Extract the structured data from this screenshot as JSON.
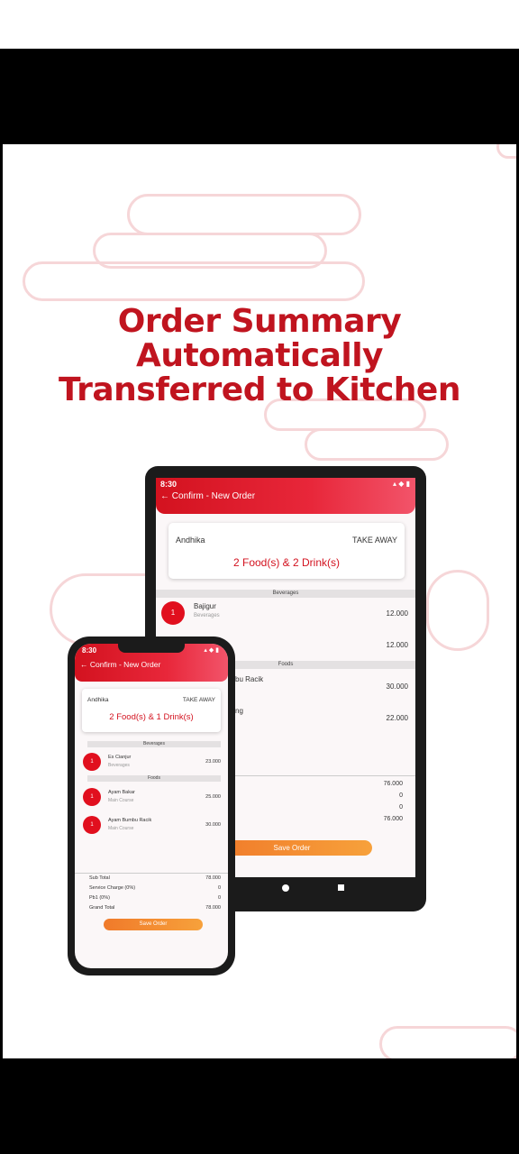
{
  "headline": {
    "line1": "Order Summary",
    "line2": "Automatically",
    "line3": "Transferred to Kitchen"
  },
  "tablet": {
    "time": "8:30",
    "status_icons": "▴ ◆ ▮",
    "back_icon": "←",
    "title": "Confirm - New Order",
    "customer": "Andhika",
    "order_type": "TAKE AWAY",
    "summary": "2 Food(s) & 2 Drink(s)",
    "sections": {
      "beverages": "Beverages",
      "foods": "Foods"
    },
    "items": [
      {
        "qty": "1",
        "name": "Bajigur",
        "category": "Beverages",
        "price": "12.000"
      },
      {
        "qty": "",
        "name": "",
        "category": "",
        "price": "12.000"
      },
      {
        "qty": "",
        "name": "bu Racik",
        "category": "",
        "price": "30.000"
      },
      {
        "qty": "",
        "name": "ng",
        "category": "",
        "price": "22.000"
      }
    ],
    "totals": [
      "76.000",
      "0",
      "0",
      "76.000"
    ],
    "save_label": "Save Order"
  },
  "phone": {
    "time": "8:30",
    "status_icons": "▴ ◆ ▮",
    "back_icon": "←",
    "title": "Confirm - New Order",
    "customer": "Andhika",
    "order_type": "TAKE AWAY",
    "summary": "2 Food(s) & 1 Drink(s)",
    "sections": {
      "beverages": "Beverages",
      "foods": "Foods"
    },
    "items": [
      {
        "qty": "1",
        "name": "Es Cianjur",
        "category": "Beverages",
        "price": "23.000"
      },
      {
        "qty": "1",
        "name": "Ayam Bakar",
        "category": "Main Course",
        "price": "25.000"
      },
      {
        "qty": "1",
        "name": "Ayam Bumbu Racik",
        "category": "Main Course",
        "price": "30.000"
      }
    ],
    "summary_rows": [
      {
        "label": "Sub Total",
        "value": "78.000"
      },
      {
        "label": "Service Charge (0%)",
        "value": "0"
      },
      {
        "label": "Pb1 (0%)",
        "value": "0"
      },
      {
        "label": "Grand Total",
        "value": "78.000"
      }
    ],
    "save_label": "Save Order"
  },
  "colors": {
    "brand_red": "#d3121f",
    "save_orange": "#f7a13b",
    "cloud_pink": "#f6d6d8"
  }
}
